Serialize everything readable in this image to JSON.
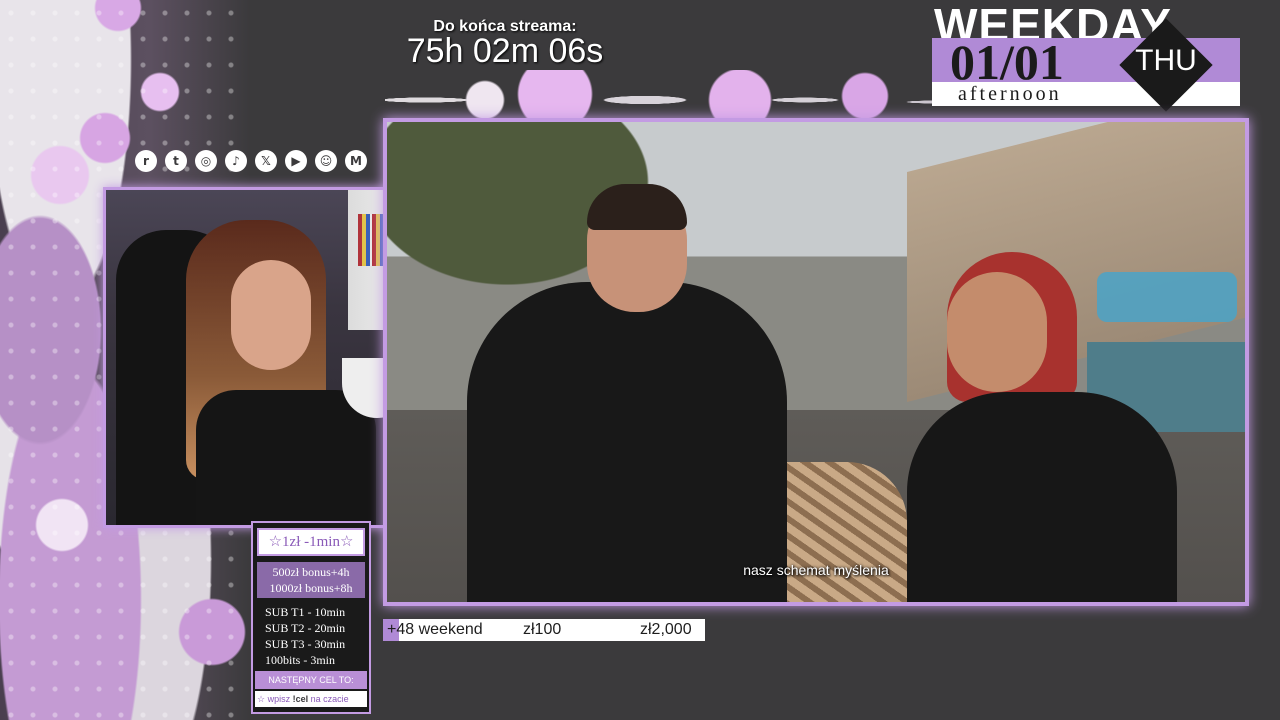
{
  "countdown": {
    "label": "Do końca streama:",
    "time": "75h 02m 06s"
  },
  "date_widget": {
    "weekday_word": "WEEKDAY",
    "date": "01/01",
    "day_of_week": "THU",
    "time_of_day": "afternoon"
  },
  "socials": [
    {
      "icon": "reddit-icon",
      "glyph": "r"
    },
    {
      "icon": "twitch-icon",
      "glyph": "t"
    },
    {
      "icon": "instagram-icon",
      "glyph": "◎"
    },
    {
      "icon": "tiktok-icon",
      "glyph": "♪"
    },
    {
      "icon": "x-icon",
      "glyph": "𝕏"
    },
    {
      "icon": "youtube-icon",
      "glyph": "▶"
    },
    {
      "icon": "discord-icon",
      "glyph": "☺"
    },
    {
      "icon": "gmail-icon",
      "glyph": "M"
    }
  ],
  "video": {
    "subtitle": "nasz schemat myślenia"
  },
  "goal": {
    "label": "+48 weekend",
    "current": "zł100",
    "target": "zł2,000",
    "progress": 0.05
  },
  "sub_panel": {
    "header": "☆1zł -1min☆",
    "bonuses": [
      "500zł bonus+4h",
      "1000zł bonus+8h"
    ],
    "tiers": [
      "SUB T1 - 10min",
      "SUB T2 - 20min",
      "SUB T3 - 30min",
      "100bits - 3min"
    ],
    "next_goal": "NASTĘPNY CEL TO:",
    "cmd_prefix": "☆ wpisz",
    "cmd_name": "!cel",
    "cmd_suffix": "na czacie"
  },
  "colors": {
    "accent": "#c39be3",
    "accent_dark": "#b08ad6",
    "background": "#3b3a3c"
  }
}
